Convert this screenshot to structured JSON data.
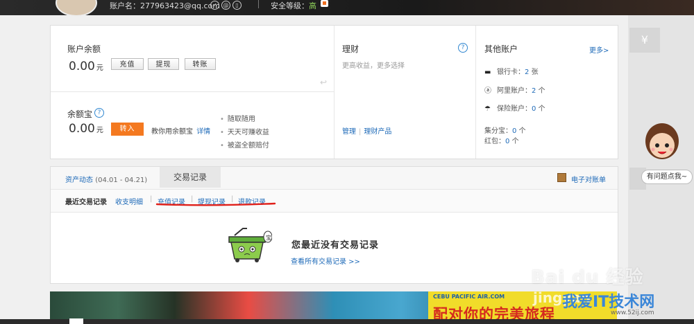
{
  "header": {
    "account_label": "账户名：277963423@qq.com",
    "security_label": "安全等级：",
    "security_level": "高"
  },
  "balance": {
    "title": "账户余额",
    "amount": "0.00",
    "unit": "元",
    "buttons": [
      "充值",
      "提现",
      "转账"
    ]
  },
  "yuebao": {
    "title": "余额宝",
    "amount": "0.00",
    "unit": "元",
    "transfer_in": "转入",
    "promo": "教你用余额宝",
    "detail_link": "详情",
    "bullets": [
      "随取随用",
      "天天可赚收益",
      "被盗全额赔付"
    ]
  },
  "licai": {
    "title": "理财",
    "subtitle": "更高收益，更多选择",
    "links": [
      "管理",
      "理财产品"
    ]
  },
  "other_accounts": {
    "title": "其他账户",
    "more": "更多>",
    "items": [
      {
        "label": "银行卡：",
        "value": "2",
        "unit": "张",
        "icon": "card-icon"
      },
      {
        "label": "阿里账户：",
        "value": "2",
        "unit": "个",
        "icon": "ali-icon"
      },
      {
        "label": "保险账户：",
        "value": "0",
        "unit": "个",
        "icon": "umbrella-icon"
      }
    ],
    "points": {
      "label": "集分宝：",
      "value": "0",
      "unit": "个"
    },
    "redpack": {
      "label": "红包：",
      "value": "0",
      "unit": "个"
    }
  },
  "records": {
    "asset_tab": "资产动态",
    "asset_range": "(04.01 - 04.21)",
    "trade_tab": "交易记录",
    "bill_link": "电子对账单",
    "sub_current": "最近交易记录",
    "sub_links": [
      "收支明细",
      "充值记录",
      "提现记录",
      "退款记录"
    ],
    "empty_message": "您最近没有交易记录",
    "empty_link": "查看所有交易记录 >>"
  },
  "side": {
    "yen": "¥",
    "help_bubble": "有问题点我~"
  },
  "banner": {
    "brand": "CEBU PACIFIC AIR.COM",
    "slogan": "配对你的完美旅程"
  },
  "watermark": {
    "line1": "Bai du 经验",
    "line2": "jingyan",
    "line3": "我爱IT技术网",
    "line4": "www.52ij.com"
  },
  "colors": {
    "accent_blue": "#1e6ab8",
    "orange": "#f47920",
    "annotation_red": "#e0201a"
  }
}
